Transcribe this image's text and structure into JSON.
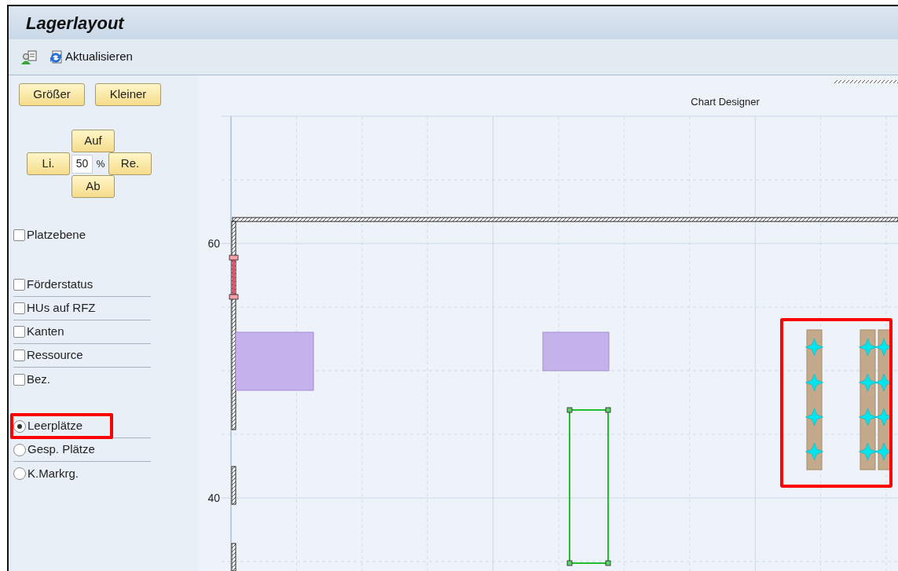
{
  "window": {
    "title": "Lagerlayout"
  },
  "toolbar": {
    "refresh_label": "Aktualisieren"
  },
  "zoom_buttons": [
    "Größer",
    "Kleiner"
  ],
  "navigation": {
    "up": "Auf",
    "left": "Li.",
    "value": "50",
    "unit": "%",
    "right": "Re.",
    "down": "Ab"
  },
  "level_checkbox": {
    "label": "Platzebene",
    "checked": false
  },
  "checkboxes": [
    {
      "label": "Förderstatus",
      "checked": false
    },
    {
      "label": "HUs auf RFZ",
      "checked": false
    },
    {
      "label": "Kanten",
      "checked": false
    },
    {
      "label": "Ressource",
      "checked": false
    },
    {
      "label": "Bez.",
      "checked": false
    }
  ],
  "radios": [
    {
      "label": "Leerplätze",
      "selected": true,
      "highlighted": true
    },
    {
      "label": "Gesp. Plätze",
      "selected": false,
      "highlighted": false
    },
    {
      "label": "K.Markrg.",
      "selected": false,
      "highlighted": false
    }
  ],
  "canvas": {
    "title": "Chart Designer",
    "y_labels": [
      "60",
      "40"
    ]
  }
}
